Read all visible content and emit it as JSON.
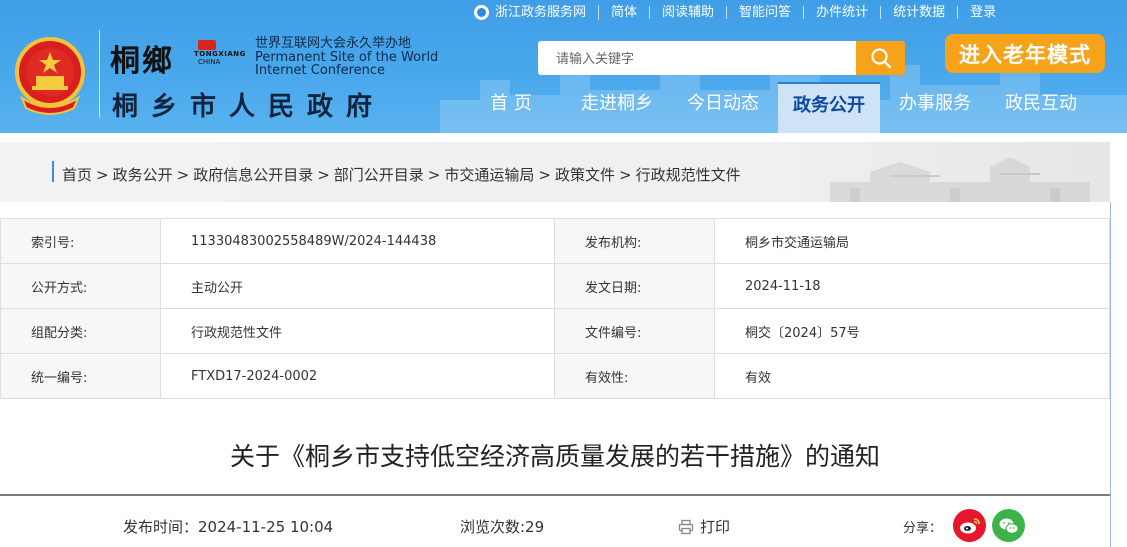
{
  "topbar": {
    "zhejiang": "浙江政务服务网",
    "links": [
      "简体",
      "阅读辅助",
      "智能问答",
      "办件统计",
      "统计数据",
      "登录"
    ]
  },
  "brand": {
    "logo_text": "桐鄉",
    "badge_line1": "TONGXIANG",
    "badge_line2": "CHINA",
    "wic_cn": "世界互联网大会永久举办地",
    "wic_en1": "Permanent Site of the World",
    "wic_en2": "Internet Conference",
    "gov_name": "桐乡市人民政府"
  },
  "search": {
    "placeholder": "请输入关键字"
  },
  "elder_mode": "进入老年模式",
  "nav": {
    "items": [
      "首 页",
      "走进桐乡",
      "今日动态",
      "政务公开",
      "办事服务",
      "政民互动"
    ],
    "active_index": 3
  },
  "breadcrumb": [
    "首页",
    "政务公开",
    "政府信息公开目录",
    "部门公开目录",
    "市交通运输局",
    "政策文件",
    "行政规范性文件"
  ],
  "breadcrumb_sep": ">",
  "meta": {
    "rows": [
      {
        "l1": "索引号:",
        "v1": "11330483002558489W/2024-144438",
        "l2": "发布机构:",
        "v2": "桐乡市交通运输局"
      },
      {
        "l1": "公开方式:",
        "v1": "主动公开",
        "l2": "发文日期:",
        "v2": "2024-11-18"
      },
      {
        "l1": "组配分类:",
        "v1": "行政规范性文件",
        "l2": "文件编号:",
        "v2": "桐交〔2024〕57号"
      },
      {
        "l1": "统一编号:",
        "v1": "FTXD17-2024-0002",
        "l2": "有效性:",
        "v2": "有效"
      }
    ]
  },
  "document": {
    "title": "关于《桐乡市支持低空经济高质量发展的若干措施》的通知",
    "publish_time": "发布时间：2024-11-25  10:04",
    "views": "浏览次数:29",
    "print_label": "打印",
    "share_label": "分享："
  },
  "colors": {
    "header_blue": "#4aa8ec",
    "accent_orange": "#f7a31a",
    "nav_active_text": "#0d4aa2",
    "weibo_red": "#e6162d",
    "wechat_green": "#3bb349"
  }
}
